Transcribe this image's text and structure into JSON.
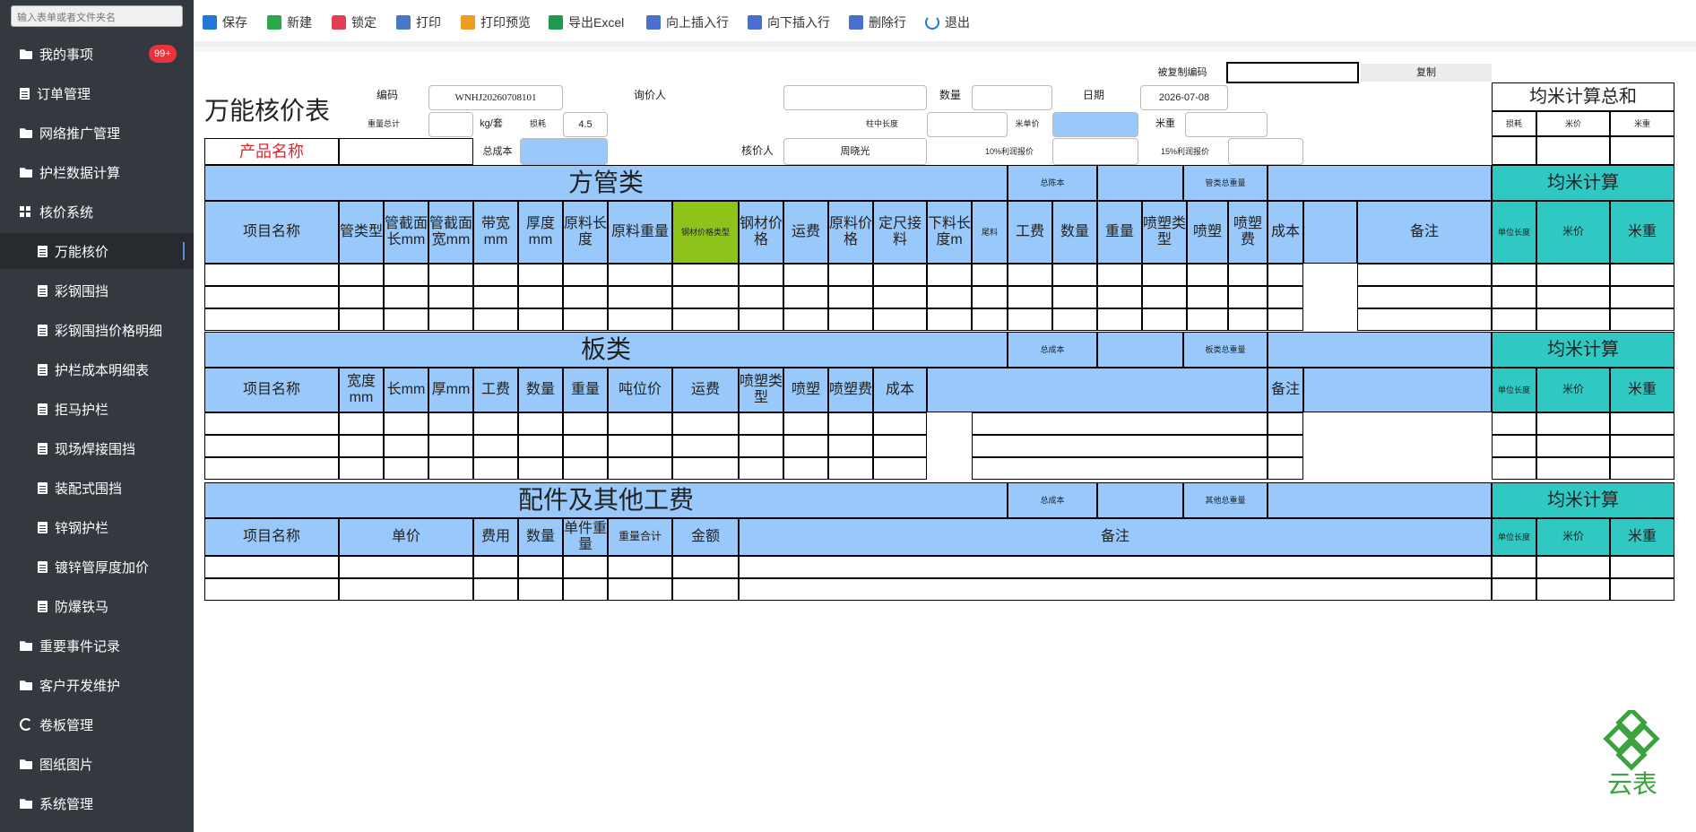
{
  "sidebar": {
    "search_placeholder": "输入表单或者文件夹名",
    "badge": "99+",
    "items": [
      {
        "label": "我的事项"
      },
      {
        "label": "订单管理"
      },
      {
        "label": "网络推广管理"
      },
      {
        "label": "护栏数据计算"
      },
      {
        "label": "核价系统"
      },
      {
        "label": "万能核价"
      },
      {
        "label": "彩钢围挡"
      },
      {
        "label": "彩钢围挡价格明细"
      },
      {
        "label": "护栏成本明细表"
      },
      {
        "label": "拒马护栏"
      },
      {
        "label": "现场焊接围挡"
      },
      {
        "label": "装配式围挡"
      },
      {
        "label": "锌钢护栏"
      },
      {
        "label": "镀锌管厚度加价"
      },
      {
        "label": "防爆铁马"
      },
      {
        "label": "重要事件记录"
      },
      {
        "label": "客户开发维护"
      },
      {
        "label": "卷板管理"
      },
      {
        "label": "图纸图片"
      },
      {
        "label": "系统管理"
      }
    ]
  },
  "toolbar": {
    "save": "保存",
    "new": "新建",
    "lock": "锁定",
    "print": "打印",
    "preview": "打印预览",
    "excel": "导出Excel",
    "insert_up": "向上插入行",
    "insert_down": "向下插入行",
    "delete_row": "删除行",
    "exit": "退出"
  },
  "form": {
    "title": "万能核价表",
    "copied_code_label": "被复制编码",
    "copy_button": "复制",
    "code_label": "编码",
    "code_value": "WNHJ20260708101",
    "inquirer_label": "询价人",
    "qty_label": "数量",
    "date_label": "日期",
    "date_value": "2026-07-08",
    "weight_total_label": "重量总计",
    "weight_unit": "kg/套",
    "loss_label": "损耗",
    "loss_value": "4.5",
    "post_length_label": "柱中长度",
    "meter_price_label": "米单价",
    "meter_weight_label": "米重",
    "product_name_label": "产品名称",
    "total_cost_label": "总成本",
    "pricer_label": "核价人",
    "pricer_value": "周晓光",
    "profit10_label": "10%利润报价",
    "profit15_label": "15%利润报价",
    "summary_title": "均米计算总和",
    "summary_cols": [
      "损耗",
      "米价",
      "米重"
    ]
  },
  "tube": {
    "title": "方管类",
    "total_cost_label": "总陈本",
    "total_weight_label": "管类总重量",
    "avg_title": "均米计算",
    "headers": [
      "项目名称",
      "管类型",
      "管截面长mm",
      "管截面宽mm",
      "带宽mm",
      "厚度mm",
      "原料长度",
      "原料重量",
      "钢材价格类型",
      "钢材价格",
      "运费",
      "原料价格",
      "定尺接料",
      "下料长度m",
      "尾料",
      "工费",
      "数量",
      "重量",
      "喷塑类型",
      "喷塑",
      "喷塑费",
      "成本",
      "",
      "备注"
    ],
    "avg_headers": [
      "单位长度",
      "米价",
      "米重"
    ]
  },
  "plate": {
    "title": "板类",
    "total_cost_label": "总成本",
    "total_weight_label": "板类总重量",
    "avg_title": "均米计算",
    "headers": [
      "项目名称",
      "宽度mm",
      "长mm",
      "厚mm",
      "工费",
      "数量",
      "重量",
      "吨位价",
      "运费",
      "喷塑类型",
      "喷塑",
      "喷塑费",
      "成本",
      "备注"
    ],
    "avg_headers": [
      "单位长度",
      "米价",
      "米重"
    ]
  },
  "parts": {
    "title": "配件及其他工费",
    "total_cost_label": "总成本",
    "total_weight_label": "其他总重量",
    "avg_title": "均米计算",
    "headers": [
      "项目名称",
      "单价",
      "费用",
      "数量",
      "单件重量",
      "重量合计",
      "金额",
      "备注"
    ],
    "avg_headers": [
      "单位长度",
      "米价",
      "米重"
    ]
  },
  "logo_text": "云表",
  "colors": {
    "header_blue": "#99c9fb",
    "teal": "#2fc8c3",
    "green": "#8ec31a",
    "sidebar": "#34393f",
    "badge": "#e8323c",
    "product_red": "#e8232a"
  }
}
